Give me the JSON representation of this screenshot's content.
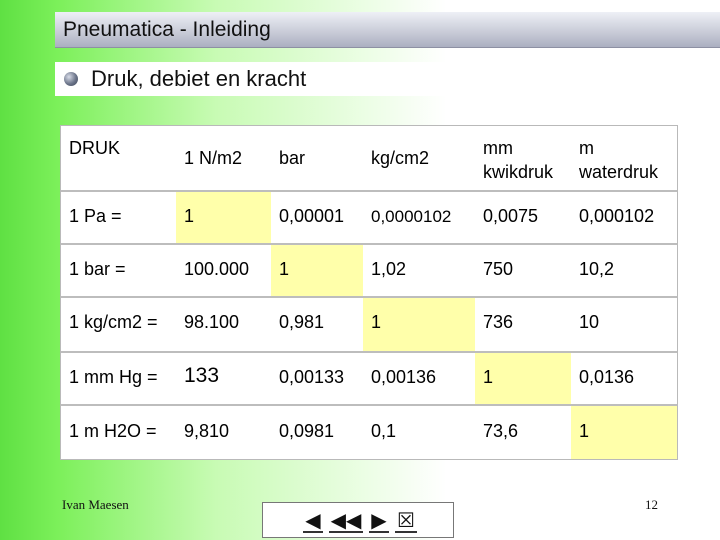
{
  "header": {
    "title": "Pneumatica - Inleiding"
  },
  "section": {
    "title": "Druk, debiet en kracht",
    "bullet_icon": "bullet-icon"
  },
  "table": {
    "header": [
      "DRUK",
      "1 N/m2",
      "bar",
      "kg/cm2",
      "mm\nkwikdruk",
      "m\nwaterdruk"
    ],
    "rows": [
      [
        "1 Pa =",
        "1",
        "0,00001",
        "0,0000102",
        "0,0075",
        "0,000102"
      ],
      [
        "1 bar =",
        "100.000",
        "1",
        "1,02",
        "750",
        "10,2"
      ],
      [
        "1 kg/cm2 =",
        "98.100",
        "0,981",
        "1",
        "736",
        "10"
      ],
      [
        "1 mm Hg =",
        "133",
        "0,00133",
        "0,00136",
        "1",
        "0,0136"
      ],
      [
        "1 m H2O =",
        "9,810",
        "0,0981",
        "0,1",
        "73,6",
        "1"
      ]
    ],
    "highlight_color": "#ffffaa"
  },
  "footer": {
    "author": "Ivan Maesen",
    "page": "12"
  },
  "nav": {
    "prev": "◀",
    "first": "◀◀",
    "next": "▶",
    "close": "☒"
  }
}
